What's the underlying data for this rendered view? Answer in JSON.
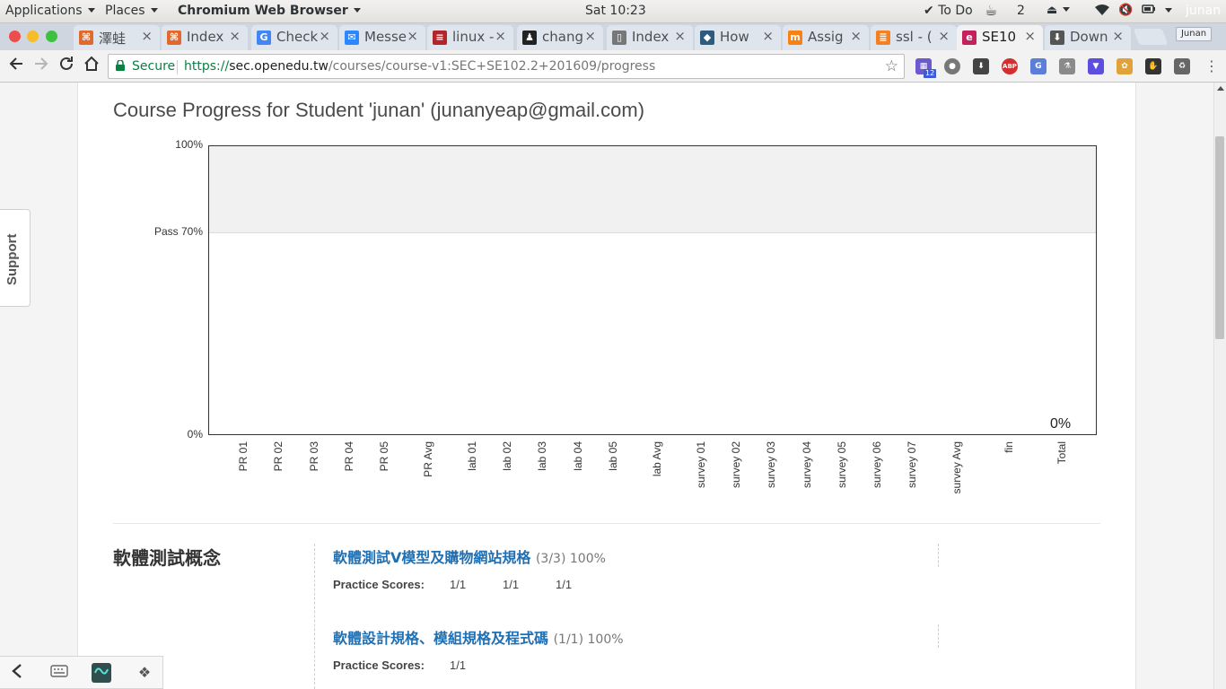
{
  "top_bar": {
    "applications": "Applications",
    "places": "Places",
    "active_app": "Chromium Web Browser",
    "clock": "Sat 10:23",
    "todo": "To Do",
    "todo_count": "2",
    "user": "junan"
  },
  "tabs": [
    {
      "title": "澤蛙",
      "favicon": "xampp-icon",
      "favicon_color": "#e06a2d"
    },
    {
      "title": "Index",
      "favicon": "xampp-icon",
      "favicon_color": "#e06a2d"
    },
    {
      "title": "Check",
      "favicon": "google-icon",
      "favicon_color": "#4285f4"
    },
    {
      "title": "Messe",
      "favicon": "messenger-icon",
      "favicon_color": "#2d88ff"
    },
    {
      "title": "linux -",
      "favicon": "linux-bars-icon",
      "favicon_color": "#b0262b"
    },
    {
      "title": "chang",
      "favicon": "tux-icon",
      "favicon_color": "#222222"
    },
    {
      "title": "Index",
      "favicon": "page-icon",
      "favicon_color": "#777777"
    },
    {
      "title": "How",
      "favicon": "stackexchange-icon",
      "favicon_color": "#2d5b7e"
    },
    {
      "title": "Assig",
      "favicon": "moodle-icon",
      "favicon_color": "#f98012"
    },
    {
      "title": "ssl - (",
      "favicon": "stackoverflow-icon",
      "favicon_color": "#f48024"
    },
    {
      "title": "SE10",
      "favicon": "edx-icon",
      "favicon_color": "#c3205c",
      "active": true
    },
    {
      "title": "Down",
      "favicon": "download-icon",
      "favicon_color": "#555555"
    }
  ],
  "profile_button": "Junan",
  "address_bar": {
    "secure_label": "Secure",
    "scheme": "https://",
    "host": "sec.openedu.tw",
    "path": "/courses/course-v1:SEC+SE102.2+201609/progress"
  },
  "extension_badge": "12",
  "support_tab": "Support",
  "page_title": "Course Progress for Student 'junan' (junanyeap@gmail.com)",
  "chart_data": {
    "type": "bar",
    "categories": [
      "PR 01",
      "PR 02",
      "PR 03",
      "PR 04",
      "PR 05",
      "PR Avg",
      "lab 01",
      "lab 02",
      "lab 03",
      "lab 04",
      "lab 05",
      "lab Avg",
      "survey 01",
      "survey 02",
      "survey 03",
      "survey 04",
      "survey 05",
      "survey 06",
      "survey 07",
      "survey Avg",
      "fin",
      "Total"
    ],
    "values": [
      0,
      0,
      0,
      0,
      0,
      0,
      0,
      0,
      0,
      0,
      0,
      0,
      0,
      0,
      0,
      0,
      0,
      0,
      0,
      0,
      0,
      0
    ],
    "ylim": [
      0,
      100
    ],
    "y_ticks": [
      {
        "value": 0,
        "label": "0%"
      },
      {
        "value": 70,
        "label": "Pass 70%"
      },
      {
        "value": 100,
        "label": "100%"
      }
    ],
    "pass_threshold": 70,
    "total_label": "0%",
    "grid": false
  },
  "chapter": {
    "title": "軟體測試概念",
    "sections": [
      {
        "title": "軟體測試V模型及購物網站規格",
        "meta": "(3/3) 100%",
        "scores_label": "Practice Scores:",
        "scores": [
          "1/1",
          "1/1",
          "1/1"
        ]
      },
      {
        "title": "軟體設計規格、模組規格及程式碼",
        "meta": "(1/1) 100%",
        "scores_label": "Practice Scores:",
        "scores": [
          "1/1"
        ]
      }
    ]
  }
}
